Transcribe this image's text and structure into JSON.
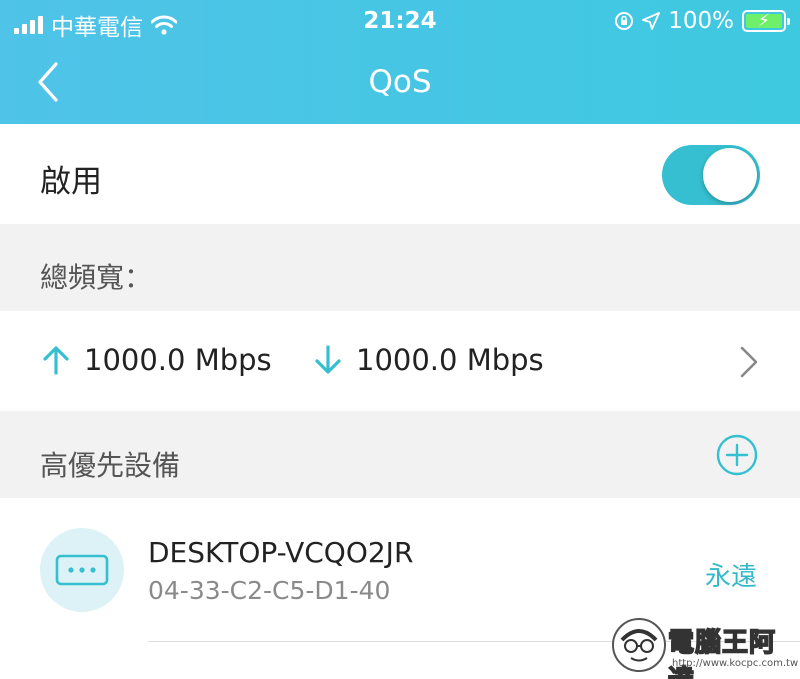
{
  "status_bar": {
    "carrier": "中華電信",
    "time": "21:24",
    "battery": "100%"
  },
  "nav": {
    "title": "QoS"
  },
  "enable": {
    "label": "啟用",
    "on": true
  },
  "bandwidth": {
    "section_label": "總頻寬：",
    "upload": "1000.0 Mbps",
    "download": "1000.0 Mbps"
  },
  "priority": {
    "section_label": "高優先設備",
    "devices": [
      {
        "name": "DESKTOP-VCQO2JR",
        "mac": "04-33-C2-C5-D1-40",
        "status": "永遠"
      }
    ]
  },
  "watermark": {
    "text": "電腦王阿達",
    "url": "http://www.kocpc.com.tw"
  },
  "colors": {
    "accent": "#35bfd0",
    "header": "#45c6e4"
  }
}
